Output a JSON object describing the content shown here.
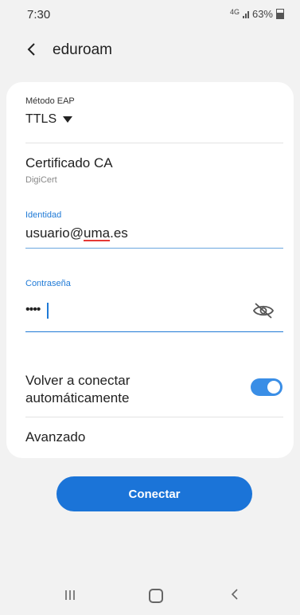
{
  "status": {
    "time": "7:30",
    "network": "4G",
    "battery": "63%"
  },
  "header": {
    "title": "eduroam"
  },
  "form": {
    "eap": {
      "label": "Método EAP",
      "value": "TTLS"
    },
    "ca": {
      "label": "Certificado CA",
      "value": "DigiCert"
    },
    "identity": {
      "label": "Identidad",
      "user": "usuario@",
      "domain": "uma",
      "tld": ".es"
    },
    "password": {
      "label": "Contraseña",
      "value": "••••"
    },
    "auto_reconnect": {
      "label_line1": "Volver a conectar",
      "label_line2": "automáticamente",
      "enabled": true
    },
    "advanced": {
      "label": "Avanzado"
    }
  },
  "actions": {
    "connect": "Conectar"
  },
  "colors": {
    "accent": "#1b74d8",
    "toggle_on": "#3a8ee6"
  }
}
